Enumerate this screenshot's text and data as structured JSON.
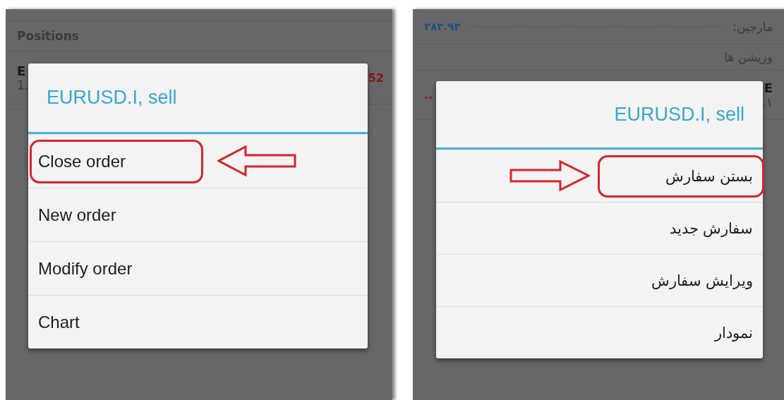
{
  "left_screen": {
    "kind": "english",
    "section_header": "Positions",
    "position_row": {
      "symbol": "E",
      "price": "1.",
      "profit": "52"
    },
    "dialog": {
      "title": "EURUSD.I, sell",
      "items": [
        {
          "label": "Close order",
          "highlighted": true
        },
        {
          "label": "New order",
          "highlighted": false
        },
        {
          "label": "Modify order",
          "highlighted": false
        },
        {
          "label": "Chart",
          "highlighted": false
        }
      ]
    }
  },
  "right_screen": {
    "kind": "persian",
    "summary_row": {
      "label": "مارجین:",
      "value": "۲۸۳.۹۳"
    },
    "section_header": "وزیشن ها",
    "position_row": {
      "symbol": "E",
      "price": "۱.",
      "profit": ".."
    },
    "dialog": {
      "title": "EURUSD.I, sell",
      "items": [
        {
          "label": "بستن سفارش",
          "highlighted": true
        },
        {
          "label": "سفارش جدید",
          "highlighted": false
        },
        {
          "label": "ویرایش سفارش",
          "highlighted": false
        },
        {
          "label": "نمودار",
          "highlighted": false
        }
      ]
    }
  }
}
